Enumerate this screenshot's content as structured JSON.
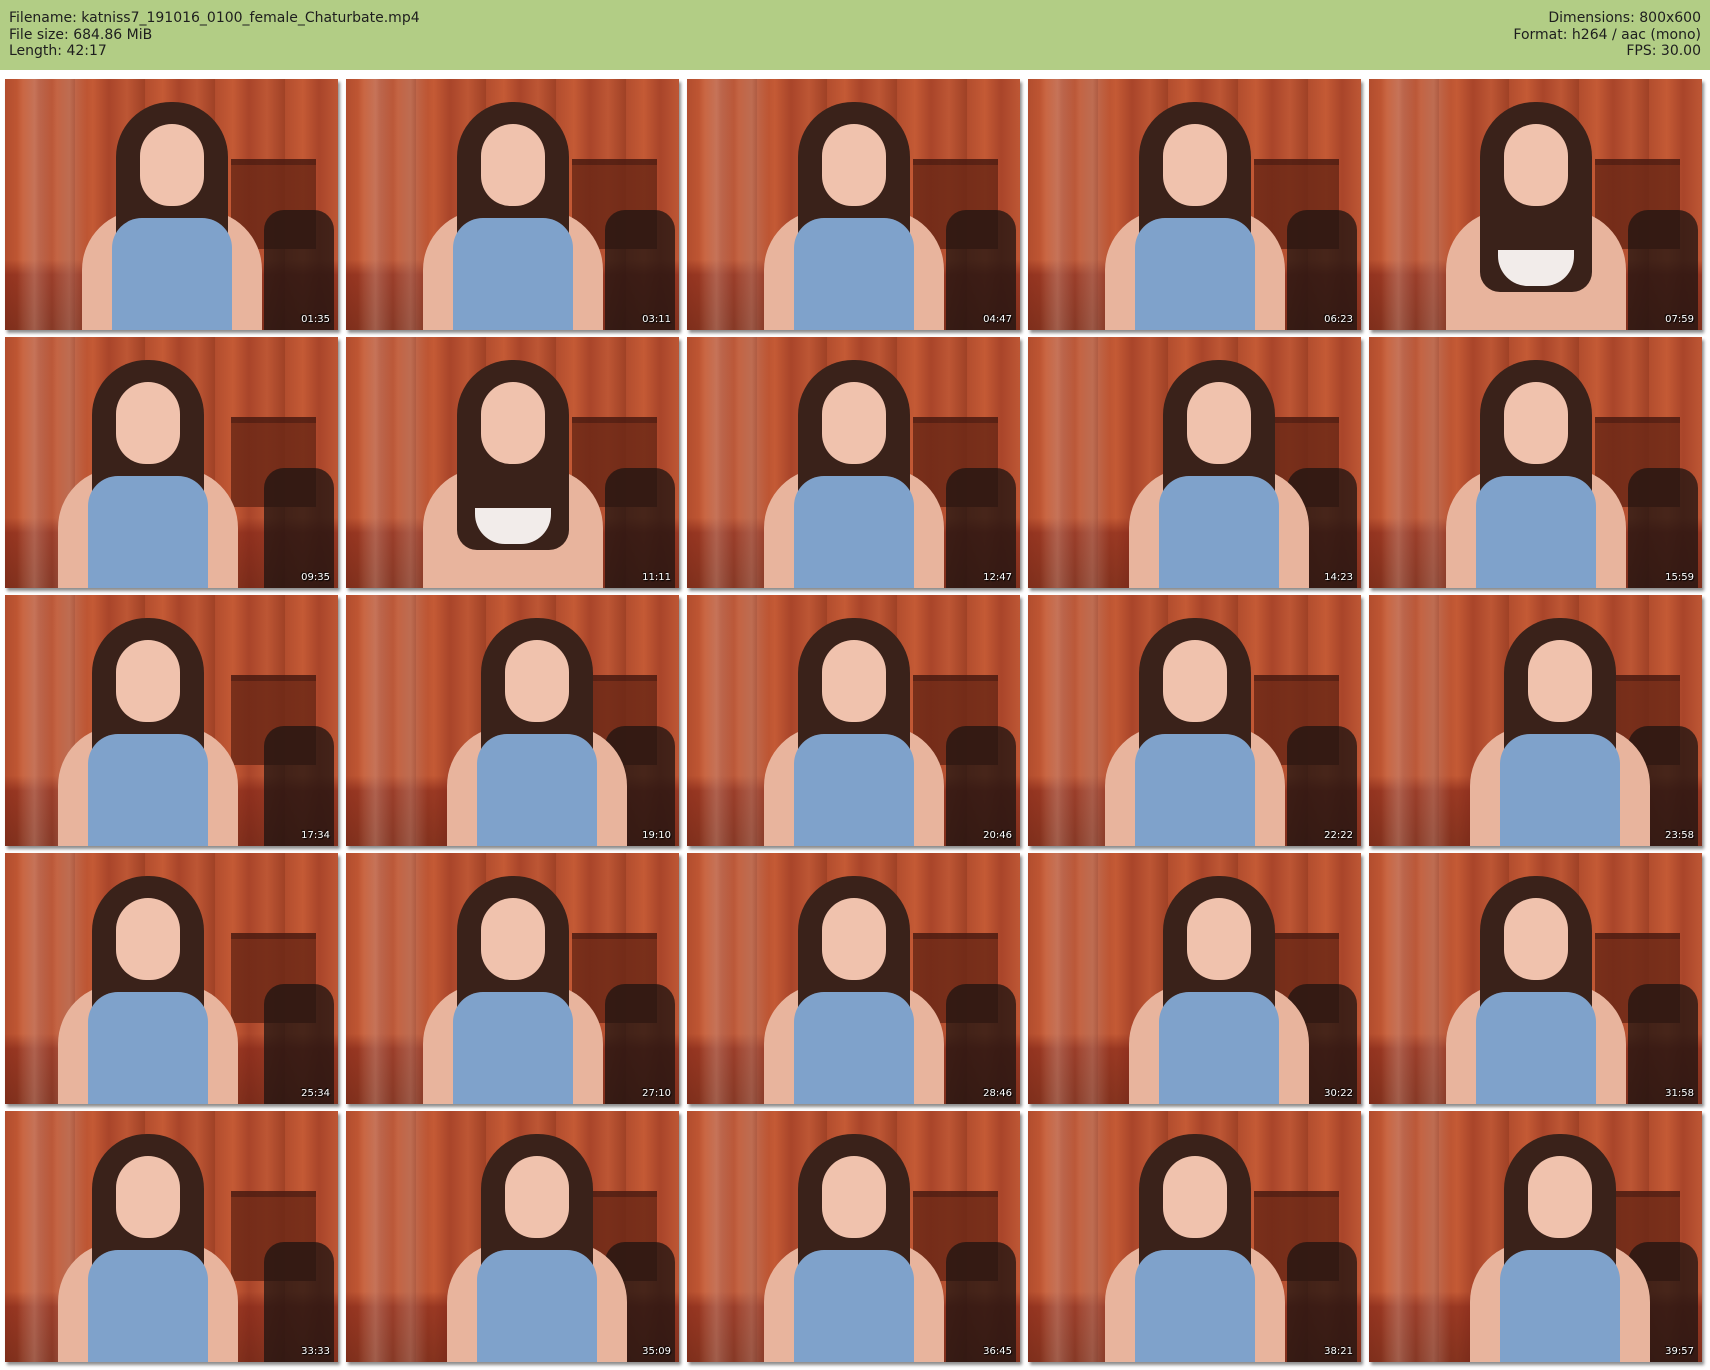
{
  "header": {
    "filename": "Filename: katniss7_191016_0100_female_Chaturbate.mp4",
    "filesize": "File size: 684.86 MiB",
    "length": "Length: 42:17",
    "dimensions": "Dimensions: 800x600",
    "format": "Format: h264 / aac (mono)",
    "fps": "FPS: 30.00"
  },
  "colors": {
    "header_bg": "#b2cd85",
    "page_bg": "#ffffff"
  },
  "thumbnails": [
    {
      "time": "01:35"
    },
    {
      "time": "03:11"
    },
    {
      "time": "04:47"
    },
    {
      "time": "06:23"
    },
    {
      "time": "07:59"
    },
    {
      "time": "09:35"
    },
    {
      "time": "11:11"
    },
    {
      "time": "12:47"
    },
    {
      "time": "14:23"
    },
    {
      "time": "15:59"
    },
    {
      "time": "17:34"
    },
    {
      "time": "19:10"
    },
    {
      "time": "20:46"
    },
    {
      "time": "22:22"
    },
    {
      "time": "23:58"
    },
    {
      "time": "25:34"
    },
    {
      "time": "27:10"
    },
    {
      "time": "28:46"
    },
    {
      "time": "30:22"
    },
    {
      "time": "31:58"
    },
    {
      "time": "33:33"
    },
    {
      "time": "35:09"
    },
    {
      "time": "36:45"
    },
    {
      "time": "38:21"
    },
    {
      "time": "39:57"
    }
  ]
}
